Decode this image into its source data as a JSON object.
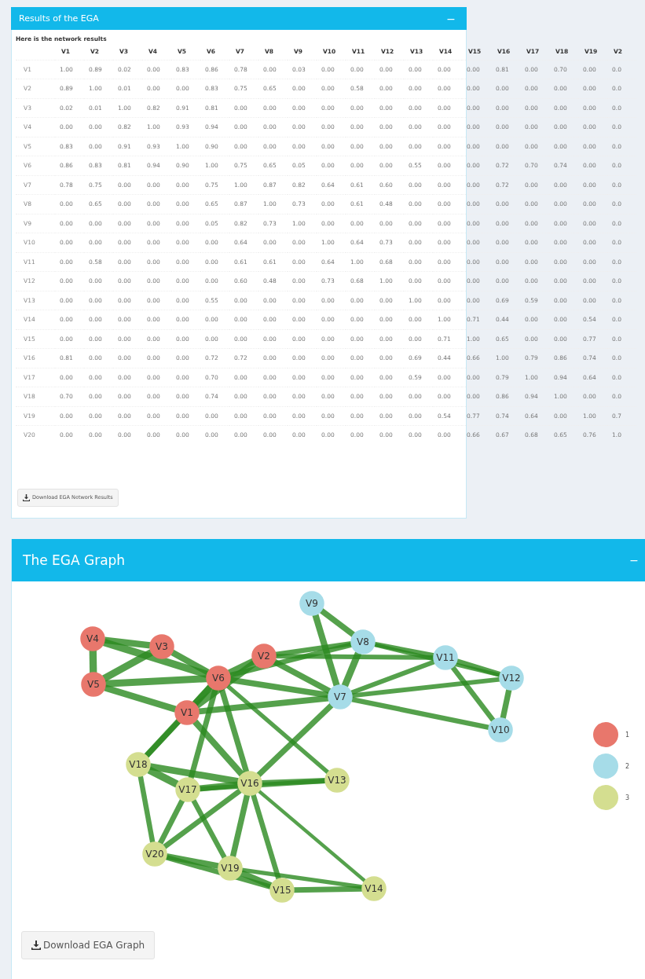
{
  "results_panel": {
    "title": "Results of the EGA",
    "collapse": "−",
    "subtitle": "Here is the network results",
    "columns": [
      "V1",
      "V2",
      "V3",
      "V4",
      "V5",
      "V6",
      "V7",
      "V8",
      "V9",
      "V10",
      "V11",
      "V12",
      "V13",
      "V14",
      "V15",
      "V16",
      "V17",
      "V18",
      "V19",
      "V2"
    ],
    "rows": [
      {
        "label": "V1",
        "values": [
          "1.00",
          "0.89",
          "0.02",
          "0.00",
          "0.83",
          "0.86",
          "0.78",
          "0.00",
          "0.03",
          "0.00",
          "0.00",
          "0.00",
          "0.00",
          "0.00",
          "0.00",
          "0.81",
          "0.00",
          "0.70",
          "0.00",
          "0.0"
        ]
      },
      {
        "label": "V2",
        "values": [
          "0.89",
          "1.00",
          "0.01",
          "0.00",
          "0.00",
          "0.83",
          "0.75",
          "0.65",
          "0.00",
          "0.00",
          "0.58",
          "0.00",
          "0.00",
          "0.00",
          "0.00",
          "0.00",
          "0.00",
          "0.00",
          "0.00",
          "0.0"
        ]
      },
      {
        "label": "V3",
        "values": [
          "0.02",
          "0.01",
          "1.00",
          "0.82",
          "0.91",
          "0.81",
          "0.00",
          "0.00",
          "0.00",
          "0.00",
          "0.00",
          "0.00",
          "0.00",
          "0.00",
          "0.00",
          "0.00",
          "0.00",
          "0.00",
          "0.00",
          "0.0"
        ]
      },
      {
        "label": "V4",
        "values": [
          "0.00",
          "0.00",
          "0.82",
          "1.00",
          "0.93",
          "0.94",
          "0.00",
          "0.00",
          "0.00",
          "0.00",
          "0.00",
          "0.00",
          "0.00",
          "0.00",
          "0.00",
          "0.00",
          "0.00",
          "0.00",
          "0.00",
          "0.0"
        ]
      },
      {
        "label": "V5",
        "values": [
          "0.83",
          "0.00",
          "0.91",
          "0.93",
          "1.00",
          "0.90",
          "0.00",
          "0.00",
          "0.00",
          "0.00",
          "0.00",
          "0.00",
          "0.00",
          "0.00",
          "0.00",
          "0.00",
          "0.00",
          "0.00",
          "0.00",
          "0.0"
        ]
      },
      {
        "label": "V6",
        "values": [
          "0.86",
          "0.83",
          "0.81",
          "0.94",
          "0.90",
          "1.00",
          "0.75",
          "0.65",
          "0.05",
          "0.00",
          "0.00",
          "0.00",
          "0.55",
          "0.00",
          "0.00",
          "0.72",
          "0.70",
          "0.74",
          "0.00",
          "0.0"
        ]
      },
      {
        "label": "V7",
        "values": [
          "0.78",
          "0.75",
          "0.00",
          "0.00",
          "0.00",
          "0.75",
          "1.00",
          "0.87",
          "0.82",
          "0.64",
          "0.61",
          "0.60",
          "0.00",
          "0.00",
          "0.00",
          "0.72",
          "0.00",
          "0.00",
          "0.00",
          "0.0"
        ]
      },
      {
        "label": "V8",
        "values": [
          "0.00",
          "0.65",
          "0.00",
          "0.00",
          "0.00",
          "0.65",
          "0.87",
          "1.00",
          "0.73",
          "0.00",
          "0.61",
          "0.48",
          "0.00",
          "0.00",
          "0.00",
          "0.00",
          "0.00",
          "0.00",
          "0.00",
          "0.0"
        ]
      },
      {
        "label": "V9",
        "values": [
          "0.00",
          "0.00",
          "0.00",
          "0.00",
          "0.00",
          "0.05",
          "0.82",
          "0.73",
          "1.00",
          "0.00",
          "0.00",
          "0.00",
          "0.00",
          "0.00",
          "0.00",
          "0.00",
          "0.00",
          "0.00",
          "0.00",
          "0.0"
        ]
      },
      {
        "label": "V10",
        "values": [
          "0.00",
          "0.00",
          "0.00",
          "0.00",
          "0.00",
          "0.00",
          "0.64",
          "0.00",
          "0.00",
          "1.00",
          "0.64",
          "0.73",
          "0.00",
          "0.00",
          "0.00",
          "0.00",
          "0.00",
          "0.00",
          "0.00",
          "0.0"
        ]
      },
      {
        "label": "V11",
        "values": [
          "0.00",
          "0.58",
          "0.00",
          "0.00",
          "0.00",
          "0.00",
          "0.61",
          "0.61",
          "0.00",
          "0.64",
          "1.00",
          "0.68",
          "0.00",
          "0.00",
          "0.00",
          "0.00",
          "0.00",
          "0.00",
          "0.00",
          "0.0"
        ]
      },
      {
        "label": "V12",
        "values": [
          "0.00",
          "0.00",
          "0.00",
          "0.00",
          "0.00",
          "0.00",
          "0.60",
          "0.48",
          "0.00",
          "0.73",
          "0.68",
          "1.00",
          "0.00",
          "0.00",
          "0.00",
          "0.00",
          "0.00",
          "0.00",
          "0.00",
          "0.0"
        ]
      },
      {
        "label": "V13",
        "values": [
          "0.00",
          "0.00",
          "0.00",
          "0.00",
          "0.00",
          "0.55",
          "0.00",
          "0.00",
          "0.00",
          "0.00",
          "0.00",
          "0.00",
          "1.00",
          "0.00",
          "0.00",
          "0.69",
          "0.59",
          "0.00",
          "0.00",
          "0.0"
        ]
      },
      {
        "label": "V14",
        "values": [
          "0.00",
          "0.00",
          "0.00",
          "0.00",
          "0.00",
          "0.00",
          "0.00",
          "0.00",
          "0.00",
          "0.00",
          "0.00",
          "0.00",
          "0.00",
          "1.00",
          "0.71",
          "0.44",
          "0.00",
          "0.00",
          "0.54",
          "0.0"
        ]
      },
      {
        "label": "V15",
        "values": [
          "0.00",
          "0.00",
          "0.00",
          "0.00",
          "0.00",
          "0.00",
          "0.00",
          "0.00",
          "0.00",
          "0.00",
          "0.00",
          "0.00",
          "0.00",
          "0.71",
          "1.00",
          "0.65",
          "0.00",
          "0.00",
          "0.77",
          "0.0"
        ]
      },
      {
        "label": "V16",
        "values": [
          "0.81",
          "0.00",
          "0.00",
          "0.00",
          "0.00",
          "0.72",
          "0.72",
          "0.00",
          "0.00",
          "0.00",
          "0.00",
          "0.00",
          "0.69",
          "0.44",
          "0.66",
          "1.00",
          "0.79",
          "0.86",
          "0.74",
          "0.0"
        ]
      },
      {
        "label": "V17",
        "values": [
          "0.00",
          "0.00",
          "0.00",
          "0.00",
          "0.00",
          "0.70",
          "0.00",
          "0.00",
          "0.00",
          "0.00",
          "0.00",
          "0.00",
          "0.59",
          "0.00",
          "0.00",
          "0.79",
          "1.00",
          "0.94",
          "0.64",
          "0.0"
        ]
      },
      {
        "label": "V18",
        "values": [
          "0.70",
          "0.00",
          "0.00",
          "0.00",
          "0.00",
          "0.74",
          "0.00",
          "0.00",
          "0.00",
          "0.00",
          "0.00",
          "0.00",
          "0.00",
          "0.00",
          "0.00",
          "0.86",
          "0.94",
          "1.00",
          "0.00",
          "0.0"
        ]
      },
      {
        "label": "V19",
        "values": [
          "0.00",
          "0.00",
          "0.00",
          "0.00",
          "0.00",
          "0.00",
          "0.00",
          "0.00",
          "0.00",
          "0.00",
          "0.00",
          "0.00",
          "0.00",
          "0.54",
          "0.77",
          "0.74",
          "0.64",
          "0.00",
          "1.00",
          "0.7"
        ]
      },
      {
        "label": "V20",
        "values": [
          "0.00",
          "0.00",
          "0.00",
          "0.00",
          "0.00",
          "0.00",
          "0.00",
          "0.00",
          "0.00",
          "0.00",
          "0.00",
          "0.00",
          "0.00",
          "0.00",
          "0.66",
          "0.67",
          "0.68",
          "0.65",
          "0.76",
          "1.0"
        ]
      }
    ],
    "download_button": "Download EGA Network Results"
  },
  "graph_panel": {
    "title": "The EGA Graph",
    "collapse": "−",
    "nodes": [
      {
        "label": "V1",
        "color": "#e8776c"
      },
      {
        "label": "V2",
        "color": "#e8776c"
      },
      {
        "label": "V3",
        "color": "#e8776c"
      },
      {
        "label": "V4",
        "color": "#e8776c"
      },
      {
        "label": "V5",
        "color": "#e8776c"
      },
      {
        "label": "V6",
        "color": "#e8776c"
      },
      {
        "label": "V7",
        "color": "#a6dce8"
      },
      {
        "label": "V8",
        "color": "#a6dce8"
      },
      {
        "label": "V9",
        "color": "#a6dce8"
      },
      {
        "label": "V10",
        "color": "#a6dce8"
      },
      {
        "label": "V11",
        "color": "#a6dce8"
      },
      {
        "label": "V12",
        "color": "#a6dce8"
      },
      {
        "label": "V13",
        "color": "#d4de90"
      },
      {
        "label": "V14",
        "color": "#d4de90"
      },
      {
        "label": "V15",
        "color": "#d4de90"
      },
      {
        "label": "V16",
        "color": "#d4de90"
      },
      {
        "label": "V17",
        "color": "#d4de90"
      },
      {
        "label": "V18",
        "color": "#d4de90"
      },
      {
        "label": "V19",
        "color": "#d4de90"
      },
      {
        "label": "V20",
        "color": "#d4de90"
      }
    ],
    "legend": [
      {
        "label": "1",
        "color": "#e8776c"
      },
      {
        "label": "2",
        "color": "#a6dce8"
      },
      {
        "label": "3",
        "color": "#d4de90"
      }
    ],
    "download_button": "Download EGA Graph"
  }
}
